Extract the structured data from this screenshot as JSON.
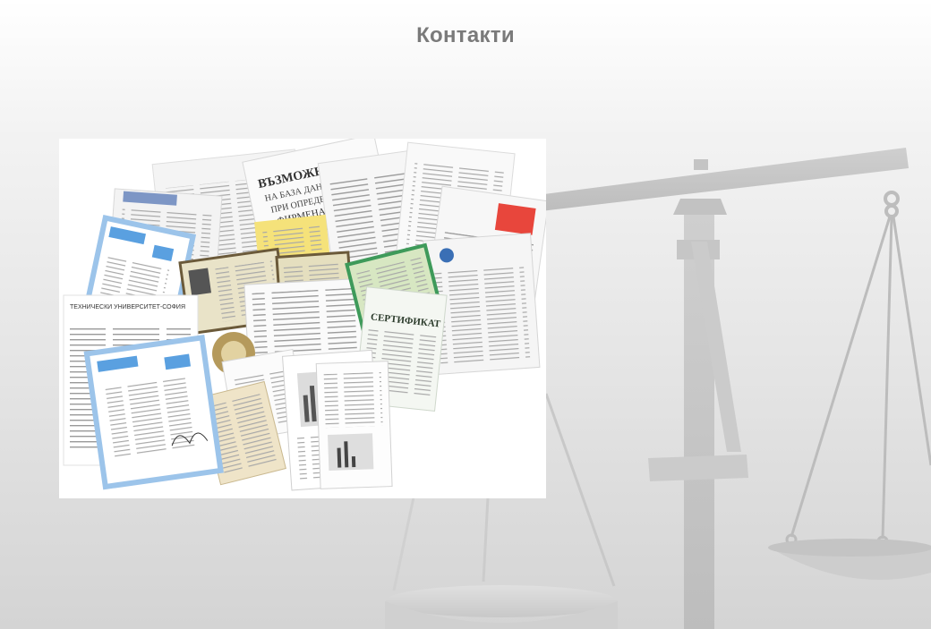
{
  "page": {
    "title": "Контакти"
  },
  "illustration": {
    "background_icon": "scales-of-justice-icon",
    "photo": "documents-collage"
  },
  "colors": {
    "title": "#7a7a7a",
    "scale_fill": "#c9c9c9",
    "background_top": "#ffffff",
    "background_bottom": "#d4d4d4",
    "certificate_blue": "#5aa0e0",
    "certificate_green": "#3e9a5a",
    "stamp_red": "#e8463c"
  }
}
